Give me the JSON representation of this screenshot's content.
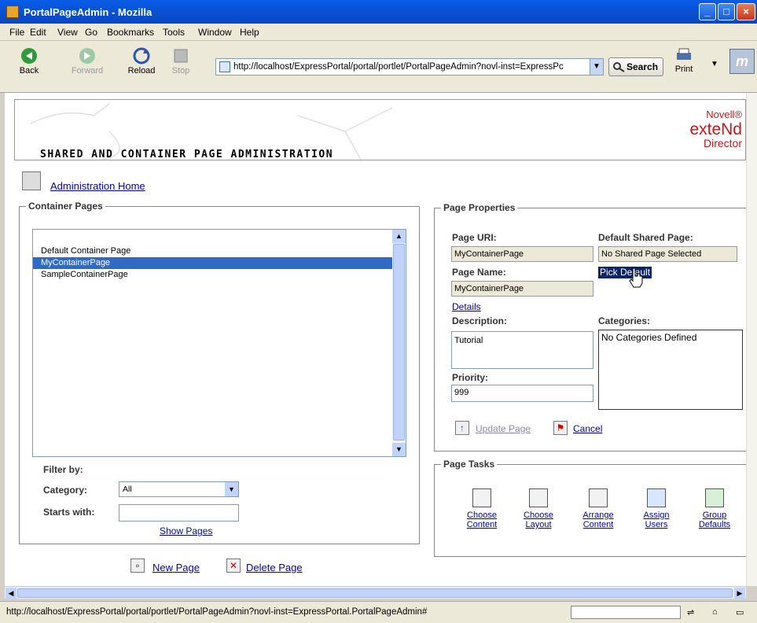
{
  "window": {
    "title": "PortalPageAdmin - Mozilla"
  },
  "menu": [
    "File",
    "Edit",
    "View",
    "Go",
    "Bookmarks",
    "Tools",
    "Window",
    "Help"
  ],
  "toolbar": {
    "back": "Back",
    "forward": "Forward",
    "reload": "Reload",
    "stop": "Stop",
    "url": "http://localhost/ExpressPortal/portal/portlet/PortalPageAdmin?novl-inst=ExpressPc",
    "search": "Search",
    "print": "Print"
  },
  "header": {
    "page_title": "SHARED AND CONTAINER PAGE ADMINISTRATION",
    "brand_line1": "Novell®",
    "brand_line2": "exteNd",
    "brand_line3": "Director"
  },
  "home_link": "Administration Home",
  "container_pages": {
    "legend": "Container Pages",
    "items": [
      "Default Container Page",
      "MyContainerPage",
      "SampleContainerPage"
    ],
    "selected": "MyContainerPage",
    "filter_label": "Filter by:",
    "category_label": "Category:",
    "category_value": "All",
    "starts_with_label": "Starts with:",
    "starts_with_value": "",
    "show_pages": "Show Pages"
  },
  "page_properties": {
    "legend": "Page Properties",
    "uri_label": "Page URI:",
    "uri_value": "MyContainerPage",
    "default_shared_label": "Default Shared Page:",
    "default_shared_value": "No Shared Page Selected",
    "name_label": "Page Name:",
    "name_value": "MyContainerPage",
    "pick_default": "Pick Default",
    "details": "Details",
    "description_label": "Description:",
    "description_value": "Tutorial",
    "categories_label": "Categories:",
    "categories_value": "No Categories Defined",
    "priority_label": "Priority:",
    "priority_value": "999",
    "update_page": "Update Page",
    "cancel": "Cancel"
  },
  "page_tasks": {
    "legend": "Page Tasks",
    "tasks": [
      {
        "l1": "Choose",
        "l2": "Content",
        "icon": "choose-content-icon"
      },
      {
        "l1": "Choose",
        "l2": "Layout",
        "icon": "choose-layout-icon"
      },
      {
        "l1": "Arrange",
        "l2": "Content",
        "icon": "arrange-content-icon"
      },
      {
        "l1": "Assign",
        "l2": "Users",
        "icon": "assign-users-icon"
      },
      {
        "l1": "Group",
        "l2": "Defaults",
        "icon": "group-defaults-icon"
      }
    ]
  },
  "actions": {
    "new_page": "New Page",
    "delete_page": "Delete Page"
  },
  "status": {
    "text": "http://localhost/ExpressPortal/portal/portlet/PortalPageAdmin?novl-inst=ExpressPortal.PortalPageAdmin#"
  }
}
